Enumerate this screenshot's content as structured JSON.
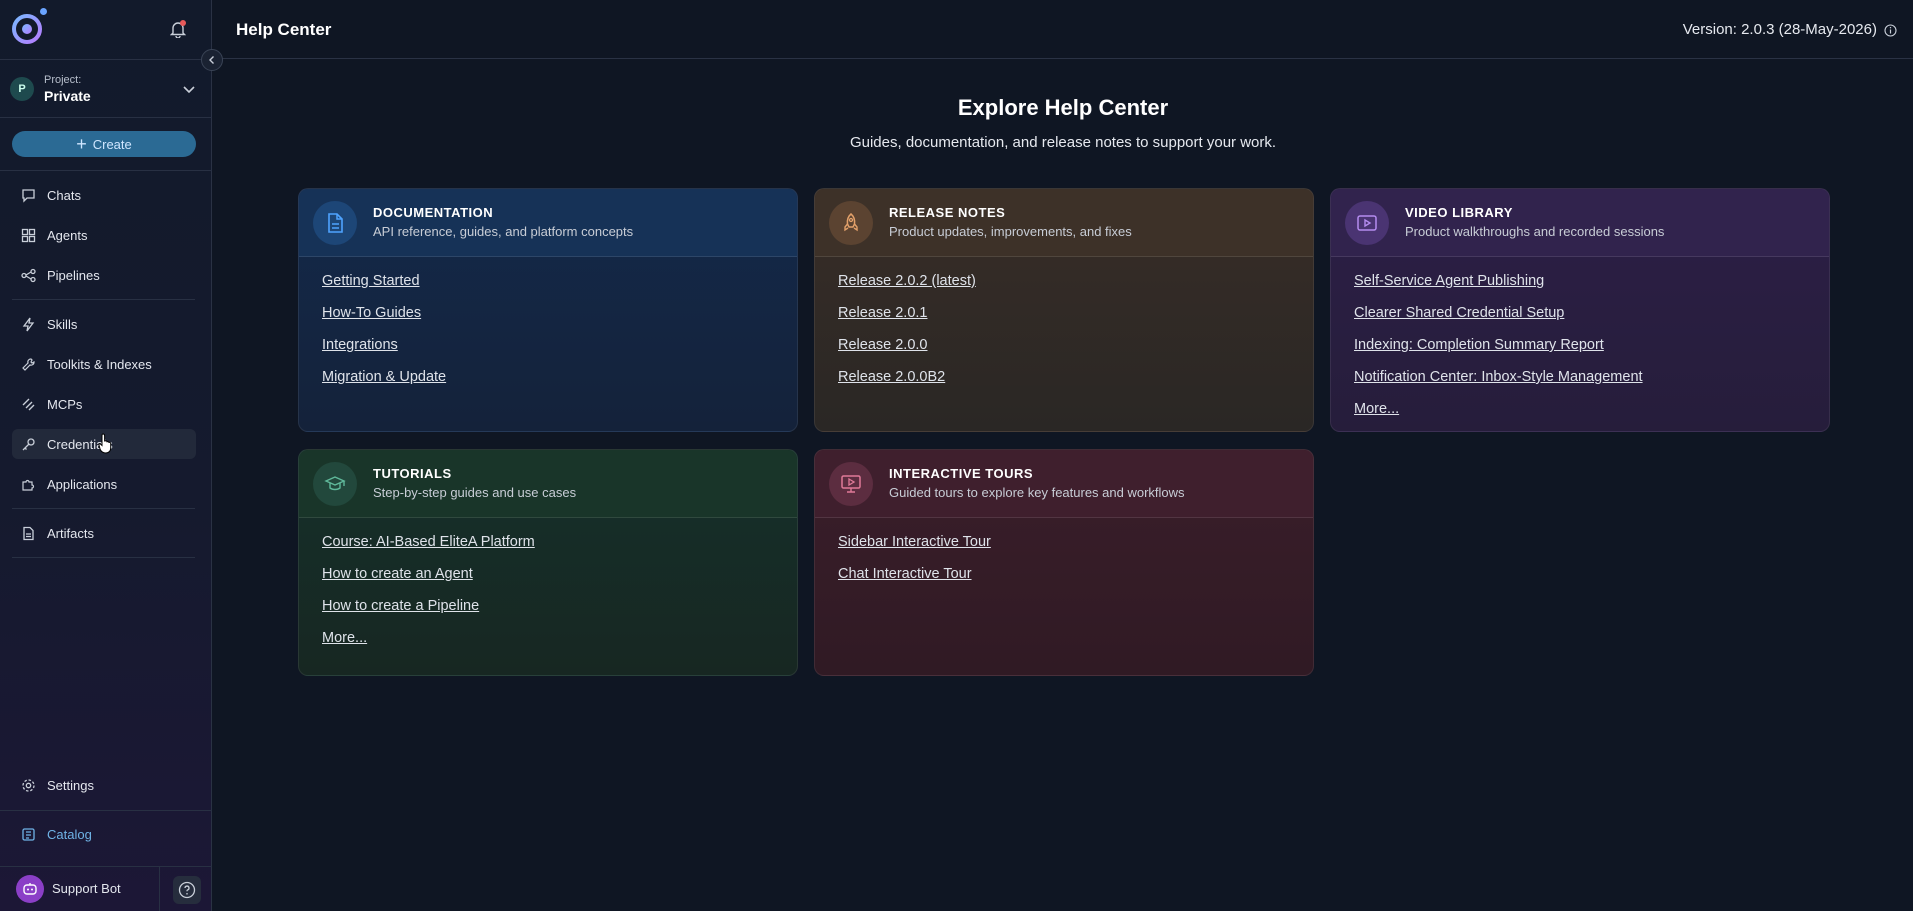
{
  "sidebar": {
    "project": {
      "label": "Project:",
      "name": "Private",
      "avatar": "P"
    },
    "create_label": "Create",
    "nav": [
      {
        "label": "Chats",
        "icon": "chat-icon"
      },
      {
        "label": "Agents",
        "icon": "agents-grid-icon"
      },
      {
        "label": "Pipelines",
        "icon": "pipeline-icon"
      },
      {
        "label": "Skills",
        "icon": "lightning-icon"
      },
      {
        "label": "Toolkits & Indexes",
        "icon": "wrench-icon"
      },
      {
        "label": "MCPs",
        "icon": "mcp-icon"
      },
      {
        "label": "Credentials",
        "icon": "key-icon"
      },
      {
        "label": "Applications",
        "icon": "puzzle-icon"
      },
      {
        "label": "Artifacts",
        "icon": "artifact-icon"
      }
    ],
    "settings_label": "Settings",
    "catalog_label": "Catalog",
    "support_label": "Support Bot"
  },
  "header": {
    "title": "Help Center",
    "version": "Version: 2.0.3 (28-May-2026)"
  },
  "main": {
    "title": "Explore Help Center",
    "subtitle": "Guides, documentation, and release notes to support your work."
  },
  "cards": {
    "documentation": {
      "title": "DOCUMENTATION",
      "subtitle": "API reference, guides, and platform concepts",
      "icon": "document-icon",
      "links": [
        "Getting Started",
        "How-To Guides",
        "Integrations",
        "Migration & Update"
      ]
    },
    "release_notes": {
      "title": "RELEASE NOTES",
      "subtitle": "Product updates, improvements, and fixes",
      "icon": "rocket-icon",
      "links": [
        "Release 2.0.2 (latest)",
        "Release 2.0.1",
        "Release 2.0.0",
        "Release 2.0.0B2"
      ]
    },
    "video_library": {
      "title": "VIDEO LIBRARY",
      "subtitle": "Product walkthroughs and recorded sessions",
      "icon": "video-icon",
      "links": [
        "Self-Service Agent Publishing",
        "Clearer Shared Credential Setup",
        "Indexing: Completion Summary Report",
        "Notification Center: Inbox-Style Management",
        "More..."
      ]
    },
    "tutorials": {
      "title": "TUTORIALS",
      "subtitle": "Step-by-step guides and use cases",
      "icon": "graduation-cap-icon",
      "links": [
        "Course: AI-Based EliteA Platform",
        "How to create an Agent",
        "How to create a Pipeline",
        "More..."
      ]
    },
    "interactive_tours": {
      "title": "INTERACTIVE TOURS",
      "subtitle": "Guided tours to explore key features and workflows",
      "icon": "monitor-play-icon",
      "links": [
        "Sidebar Interactive Tour",
        "Chat Interactive Tour"
      ]
    }
  },
  "colors": {
    "background": "#0f1623",
    "accent": "#2b6a94",
    "catalog": "#6fb3e6"
  }
}
